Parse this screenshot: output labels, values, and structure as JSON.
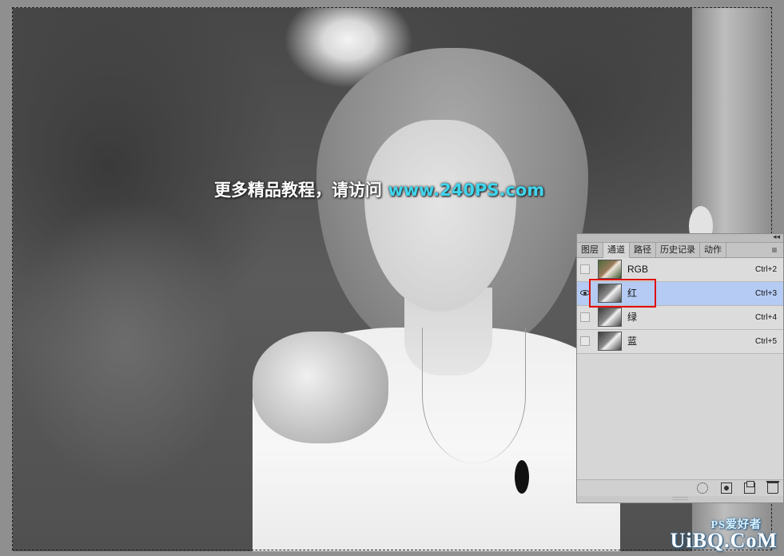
{
  "watermark": {
    "text": "更多精品教程，请访问 ",
    "url": "www.240PS.com"
  },
  "corner_logo": {
    "brand": "UiBQ.CoM",
    "tag": "PS爱好者"
  },
  "channels_panel": {
    "tabs": [
      {
        "label": "图层",
        "active": false
      },
      {
        "label": "通道",
        "active": true
      },
      {
        "label": "路径",
        "active": false
      },
      {
        "label": "历史记录",
        "active": false
      },
      {
        "label": "动作",
        "active": false
      }
    ],
    "menu_icon": "≡",
    "collapse_icon": "◂◂",
    "channels": [
      {
        "name": "RGB",
        "shortcut": "Ctrl+2",
        "visible": false,
        "selected": false,
        "thumb": "color"
      },
      {
        "name": "红",
        "shortcut": "Ctrl+3",
        "visible": true,
        "selected": true,
        "thumb": "gray"
      },
      {
        "name": "绿",
        "shortcut": "Ctrl+4",
        "visible": false,
        "selected": false,
        "thumb": "gray"
      },
      {
        "name": "蓝",
        "shortcut": "Ctrl+5",
        "visible": false,
        "selected": false,
        "thumb": "gray"
      }
    ],
    "footer_icons": [
      "load-selection-icon",
      "save-selection-icon",
      "new-channel-icon",
      "trash-icon"
    ],
    "grip": "::::::::::"
  },
  "colors": {
    "selected_row": "#b5cbf3",
    "highlight_border": "#e01010",
    "watermark_url": "#3fd6ee"
  }
}
